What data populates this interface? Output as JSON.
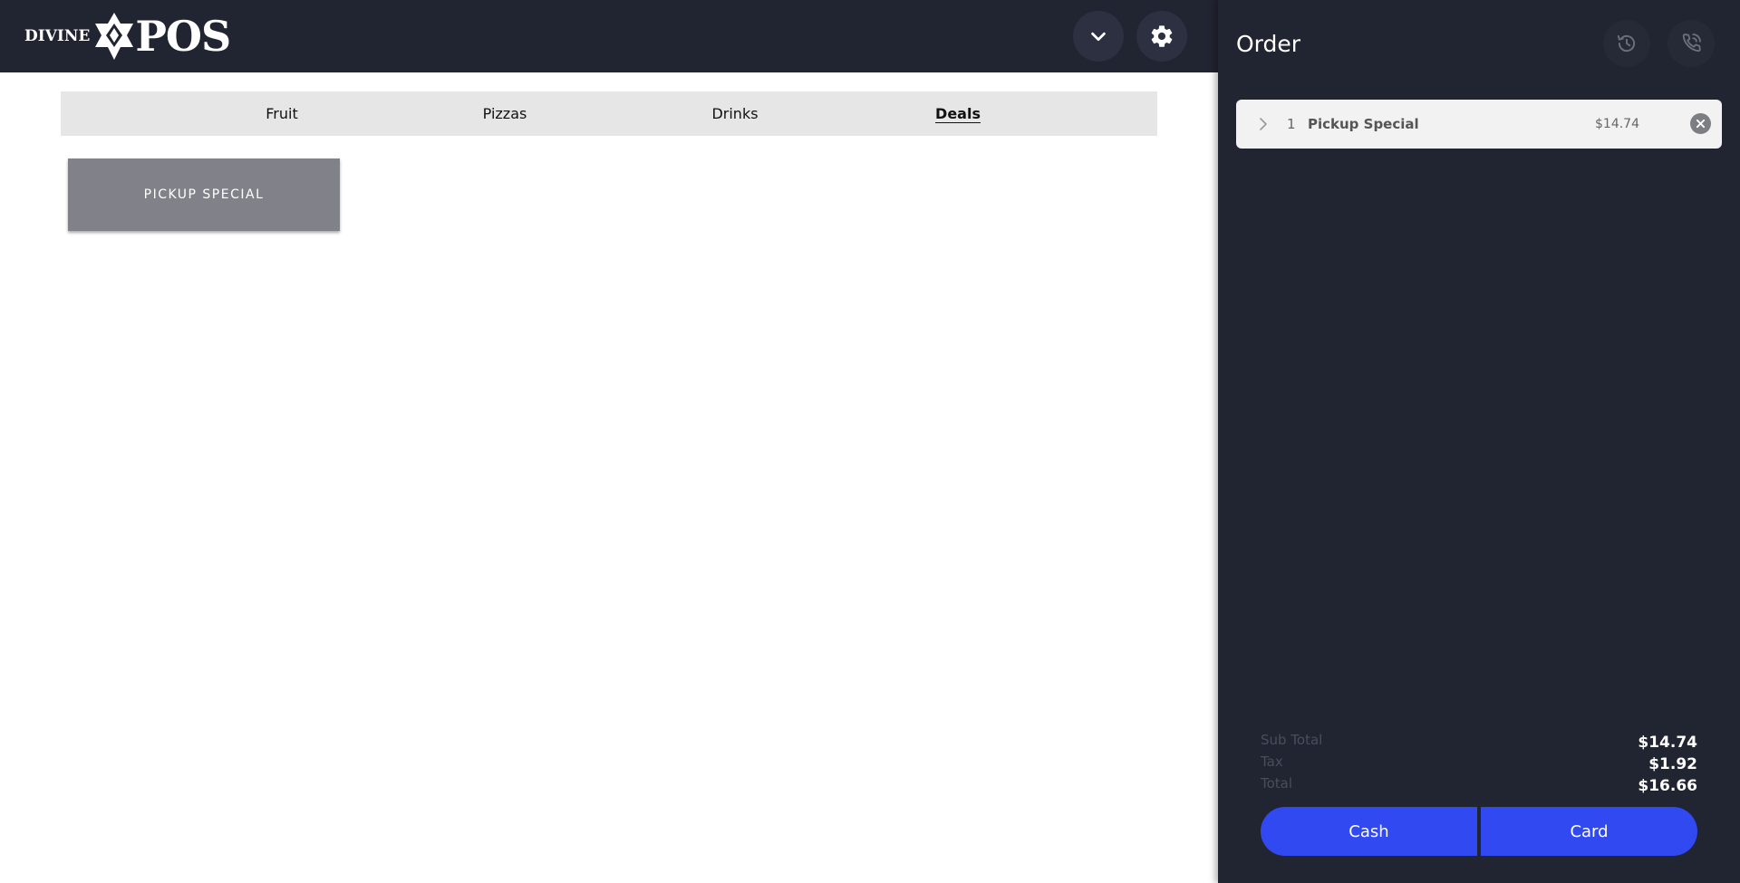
{
  "brand": {
    "left": "DIVINE",
    "right": "POS"
  },
  "header": {
    "dropdown_icon": "chevron-down-icon",
    "settings_icon": "gear-icon"
  },
  "categories": [
    {
      "label": "Fruit",
      "active": false
    },
    {
      "label": "Pizzas",
      "active": false
    },
    {
      "label": "Drinks",
      "active": false
    },
    {
      "label": "Deals",
      "active": true
    }
  ],
  "items": [
    {
      "label": "PICKUP SPECIAL"
    }
  ],
  "order": {
    "title": "Order",
    "history_icon": "history-icon",
    "phone_icon": "phone-icon",
    "lines": [
      {
        "qty": "1",
        "name": "Pickup Special",
        "price": "$14.74"
      }
    ],
    "totals": {
      "subtotal_label": "Sub Total",
      "subtotal": "$14.74",
      "tax_label": "Tax",
      "tax": "$1.92",
      "total_label": "Total",
      "total": "$16.66"
    },
    "cash_label": "Cash",
    "card_label": "Card"
  },
  "colors": {
    "header_bg": "#212431",
    "accent": "#3149f0",
    "tile_bg": "#818289",
    "tabs_bg": "#e6e6e6"
  }
}
